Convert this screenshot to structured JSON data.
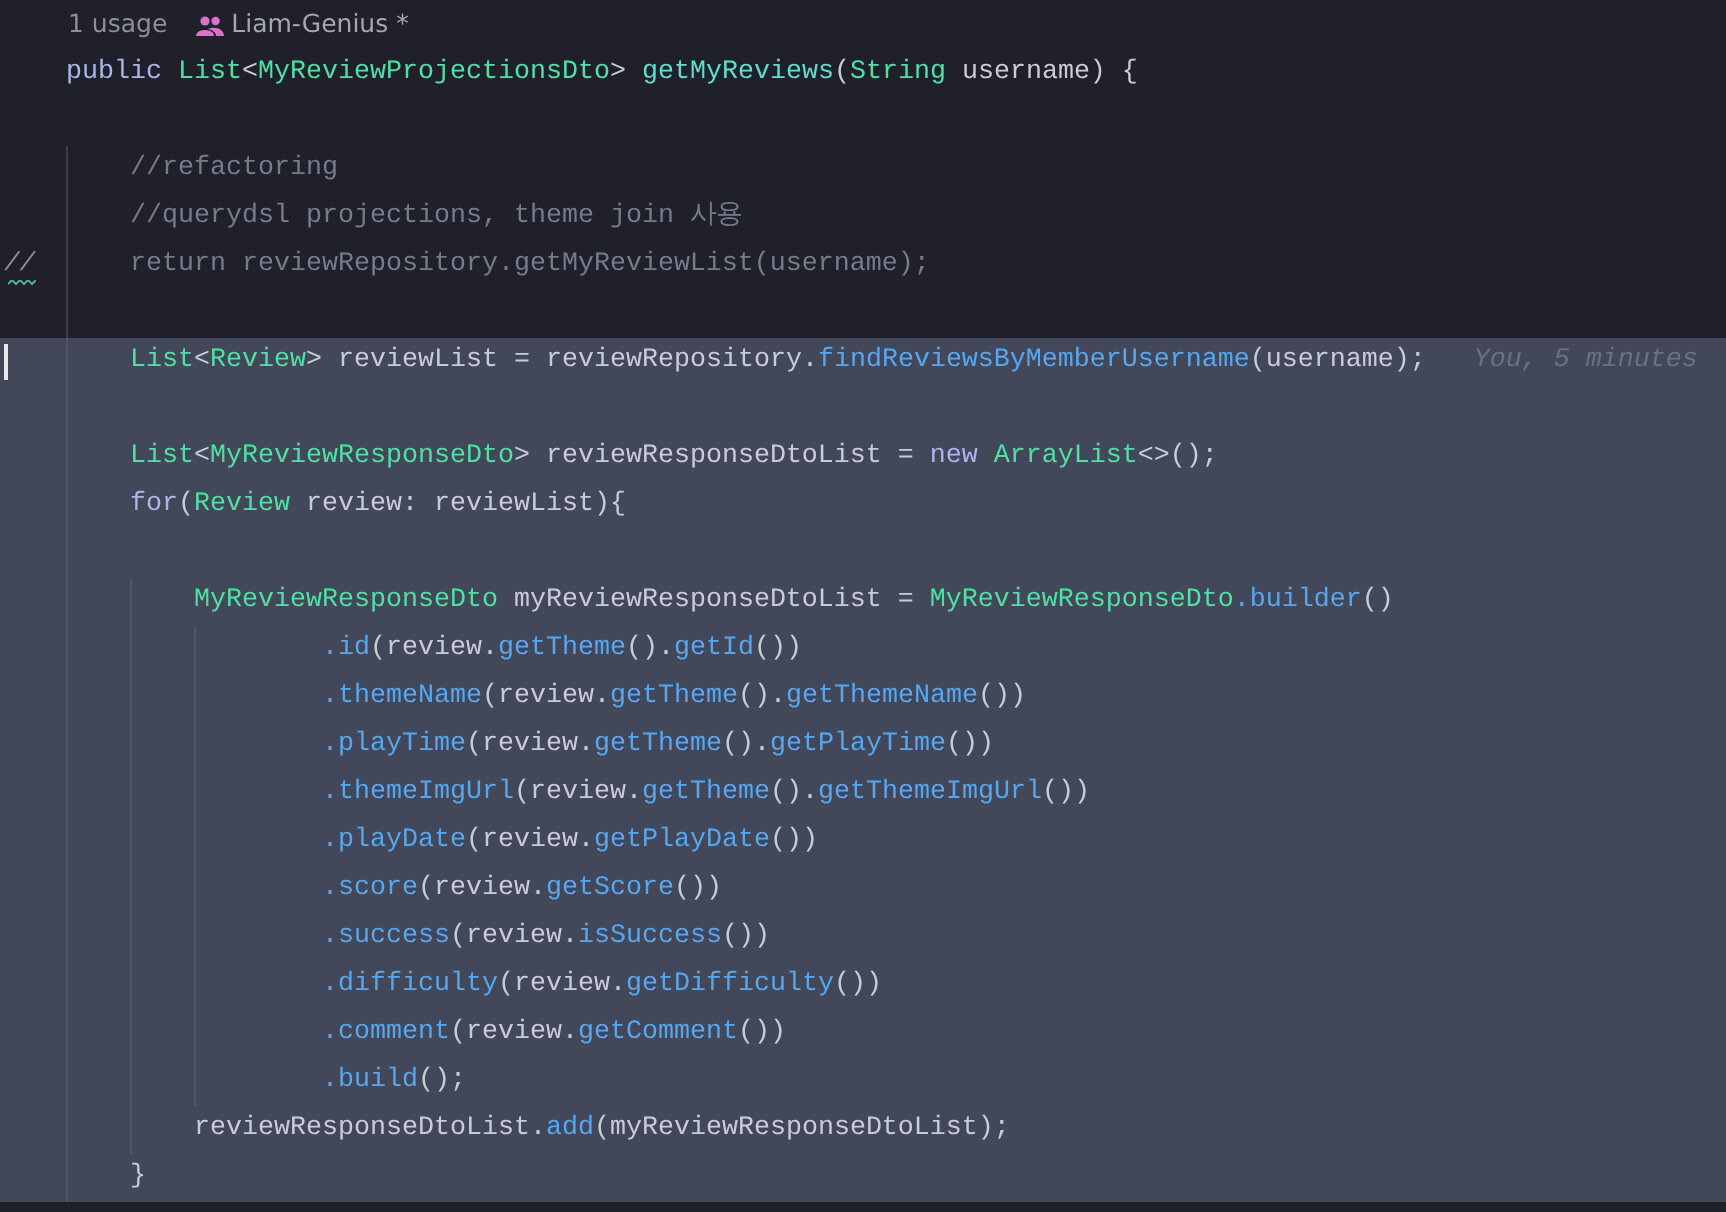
{
  "code_vision": {
    "usages": "1 usage",
    "author": "Liam-Genius *"
  },
  "lines": [
    {
      "highlighted": false,
      "caret": false,
      "tokens": [
        {
          "kind": "keyword",
          "text": "public "
        },
        {
          "kind": "type",
          "text": "List"
        },
        {
          "kind": "plain",
          "text": "<"
        },
        {
          "kind": "type",
          "text": "MyReviewProjectionsDto"
        },
        {
          "kind": "plain",
          "text": "> "
        },
        {
          "kind": "declaration",
          "text": "getMyReviews"
        },
        {
          "kind": "plain",
          "text": "("
        },
        {
          "kind": "type",
          "text": "String"
        },
        {
          "kind": "plain",
          "text": " username) {"
        }
      ]
    },
    {
      "highlighted": false,
      "caret": false
    },
    {
      "highlighted": false,
      "caret": false,
      "tokens": [
        {
          "kind": "comment",
          "text": "    //refactoring"
        }
      ]
    },
    {
      "highlighted": false,
      "caret": false,
      "tokens": [
        {
          "kind": "comment",
          "text": "    //querydsl projections, theme join 사용"
        }
      ]
    },
    {
      "highlighted": false,
      "caret": false,
      "gutter_mark": "//",
      "tokens": [
        {
          "kind": "comment",
          "text": "    return reviewRepository.getMyReviewList(username);"
        }
      ]
    },
    {
      "highlighted": false,
      "caret": false
    },
    {
      "highlighted": true,
      "caret": true,
      "inlay_hint": "You, 5 minutes",
      "tokens": [
        {
          "kind": "type",
          "text": "    List"
        },
        {
          "kind": "plain",
          "text": "<"
        },
        {
          "kind": "type",
          "text": "Review"
        },
        {
          "kind": "plain",
          "text": "> reviewList = reviewRepository."
        },
        {
          "kind": "call",
          "text": "findReviewsByMemberUsername"
        },
        {
          "kind": "plain",
          "text": "(username);"
        }
      ]
    },
    {
      "highlighted": true,
      "caret": false
    },
    {
      "highlighted": true,
      "caret": false,
      "tokens": [
        {
          "kind": "type",
          "text": "    List"
        },
        {
          "kind": "plain",
          "text": "<"
        },
        {
          "kind": "type",
          "text": "MyReviewResponseDto"
        },
        {
          "kind": "plain",
          "text": "> reviewResponseDtoList = "
        },
        {
          "kind": "keyword",
          "text": "new "
        },
        {
          "kind": "type",
          "text": "ArrayList"
        },
        {
          "kind": "plain",
          "text": "<>();"
        }
      ]
    },
    {
      "highlighted": true,
      "caret": false,
      "tokens": [
        {
          "kind": "keyword",
          "text": "    for"
        },
        {
          "kind": "plain",
          "text": "("
        },
        {
          "kind": "type",
          "text": "Review"
        },
        {
          "kind": "plain",
          "text": " review: reviewList){"
        }
      ]
    },
    {
      "highlighted": true,
      "caret": false
    },
    {
      "highlighted": true,
      "caret": false,
      "tokens": [
        {
          "kind": "type",
          "text": "        MyReviewResponseDto"
        },
        {
          "kind": "plain",
          "text": " myReviewResponseDtoList = "
        },
        {
          "kind": "type",
          "text": "MyReviewResponseDto"
        },
        {
          "kind": "call",
          "text": ".builder"
        },
        {
          "kind": "plain",
          "text": "()"
        }
      ]
    },
    {
      "highlighted": true,
      "caret": false,
      "tokens": [
        {
          "kind": "call",
          "text": "                .id"
        },
        {
          "kind": "plain",
          "text": "(review."
        },
        {
          "kind": "call",
          "text": "getTheme"
        },
        {
          "kind": "plain",
          "text": "()."
        },
        {
          "kind": "call",
          "text": "getId"
        },
        {
          "kind": "plain",
          "text": "())"
        }
      ]
    },
    {
      "highlighted": true,
      "caret": false,
      "tokens": [
        {
          "kind": "call",
          "text": "                .themeName"
        },
        {
          "kind": "plain",
          "text": "(review."
        },
        {
          "kind": "call",
          "text": "getTheme"
        },
        {
          "kind": "plain",
          "text": "()."
        },
        {
          "kind": "call",
          "text": "getThemeName"
        },
        {
          "kind": "plain",
          "text": "())"
        }
      ]
    },
    {
      "highlighted": true,
      "caret": false,
      "tokens": [
        {
          "kind": "call",
          "text": "                .playTime"
        },
        {
          "kind": "plain",
          "text": "(review."
        },
        {
          "kind": "call",
          "text": "getTheme"
        },
        {
          "kind": "plain",
          "text": "()."
        },
        {
          "kind": "call",
          "text": "getPlayTime"
        },
        {
          "kind": "plain",
          "text": "())"
        }
      ]
    },
    {
      "highlighted": true,
      "caret": false,
      "tokens": [
        {
          "kind": "call",
          "text": "                .themeImgUrl"
        },
        {
          "kind": "plain",
          "text": "(review."
        },
        {
          "kind": "call",
          "text": "getTheme"
        },
        {
          "kind": "plain",
          "text": "()."
        },
        {
          "kind": "call",
          "text": "getThemeImgUrl"
        },
        {
          "kind": "plain",
          "text": "())"
        }
      ]
    },
    {
      "highlighted": true,
      "caret": false,
      "tokens": [
        {
          "kind": "call",
          "text": "                .playDate"
        },
        {
          "kind": "plain",
          "text": "(review."
        },
        {
          "kind": "call",
          "text": "getPlayDate"
        },
        {
          "kind": "plain",
          "text": "())"
        }
      ]
    },
    {
      "highlighted": true,
      "caret": false,
      "tokens": [
        {
          "kind": "call",
          "text": "                .score"
        },
        {
          "kind": "plain",
          "text": "(review."
        },
        {
          "kind": "call",
          "text": "getScore"
        },
        {
          "kind": "plain",
          "text": "())"
        }
      ]
    },
    {
      "highlighted": true,
      "caret": false,
      "tokens": [
        {
          "kind": "call",
          "text": "                .success"
        },
        {
          "kind": "plain",
          "text": "(review."
        },
        {
          "kind": "call",
          "text": "isSuccess"
        },
        {
          "kind": "plain",
          "text": "())"
        }
      ]
    },
    {
      "highlighted": true,
      "caret": false,
      "tokens": [
        {
          "kind": "call",
          "text": "                .difficulty"
        },
        {
          "kind": "plain",
          "text": "(review."
        },
        {
          "kind": "call",
          "text": "getDifficulty"
        },
        {
          "kind": "plain",
          "text": "())"
        }
      ]
    },
    {
      "highlighted": true,
      "caret": false,
      "tokens": [
        {
          "kind": "call",
          "text": "                .comment"
        },
        {
          "kind": "plain",
          "text": "(review."
        },
        {
          "kind": "call",
          "text": "getComment"
        },
        {
          "kind": "plain",
          "text": "())"
        }
      ]
    },
    {
      "highlighted": true,
      "caret": false,
      "tokens": [
        {
          "kind": "call",
          "text": "                .build"
        },
        {
          "kind": "plain",
          "text": "();"
        }
      ]
    },
    {
      "highlighted": true,
      "caret": false,
      "tokens": [
        {
          "kind": "plain",
          "text": "        reviewResponseDtoList."
        },
        {
          "kind": "call",
          "text": "add"
        },
        {
          "kind": "plain",
          "text": "(myReviewResponseDtoList);"
        }
      ]
    },
    {
      "highlighted": true,
      "caret": false,
      "tokens": [
        {
          "kind": "plain",
          "text": "    }"
        }
      ]
    }
  ]
}
